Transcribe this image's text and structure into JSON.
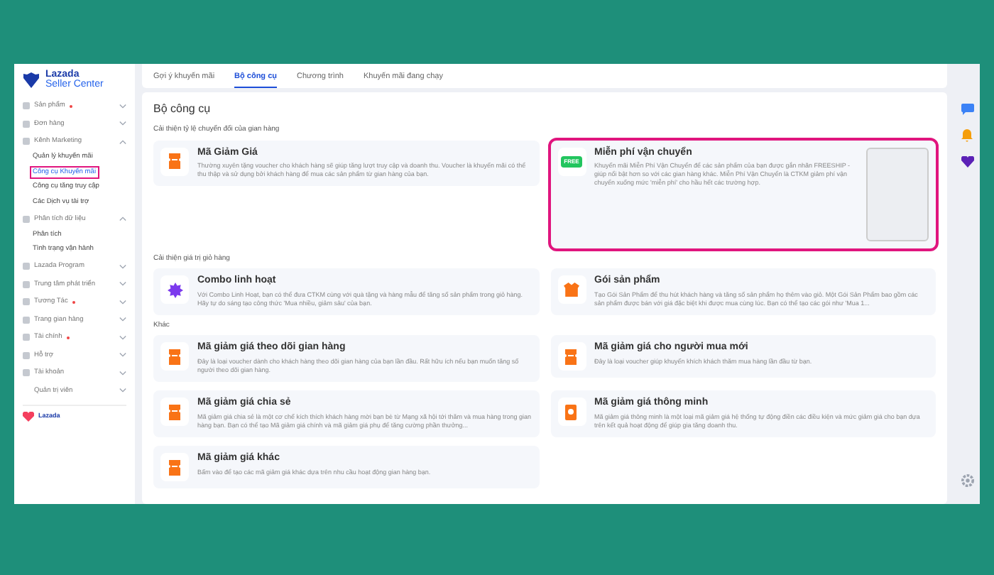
{
  "logo": {
    "line1": "Lazada",
    "line2": "Seller Center"
  },
  "sidebar": {
    "items": [
      {
        "label": "Sản phẩm",
        "kind": "group",
        "alert": true,
        "expanded": false
      },
      {
        "label": "Đơn hàng",
        "kind": "group",
        "alert": false,
        "expanded": false
      },
      {
        "label": "Kênh Marketing",
        "kind": "group",
        "alert": false,
        "expanded": true,
        "children": [
          {
            "label": "Quản lý khuyến mãi",
            "selected": false,
            "highlighted": false
          },
          {
            "label": "Công cụ Khuyến mãi",
            "selected": true,
            "highlighted": true
          },
          {
            "label": "Công cụ tăng truy cập",
            "selected": false,
            "highlighted": false
          },
          {
            "label": "Các Dịch vụ tài trợ",
            "selected": false,
            "highlighted": false
          }
        ]
      },
      {
        "label": "Phân tích dữ liệu",
        "kind": "group",
        "alert": false,
        "expanded": true,
        "children": [
          {
            "label": "Phân tích",
            "selected": false,
            "highlighted": false
          },
          {
            "label": "Tình trạng vận hành",
            "selected": false,
            "highlighted": false
          }
        ]
      },
      {
        "label": "Lazada Program",
        "kind": "group",
        "alert": false,
        "expanded": false
      },
      {
        "label": "Trung tâm phát triển",
        "kind": "group",
        "alert": false,
        "expanded": false
      },
      {
        "label": "Tương Tác",
        "kind": "group",
        "alert": true,
        "expanded": false
      },
      {
        "label": "Trang gian hàng",
        "kind": "group",
        "alert": false,
        "expanded": false
      },
      {
        "label": "Tài chính",
        "kind": "group",
        "alert": true,
        "expanded": false
      },
      {
        "label": "Hỗ trợ",
        "kind": "group",
        "alert": false,
        "expanded": false
      },
      {
        "label": "Tài khoản",
        "kind": "group",
        "alert": false,
        "expanded": false
      },
      {
        "label": "Quản trị viên",
        "kind": "plain",
        "alert": false,
        "expanded": false
      }
    ],
    "footer": "Lazada"
  },
  "tabs": [
    {
      "label": "Gợi ý khuyến mãi",
      "selected": false
    },
    {
      "label": "Bộ công cụ",
      "selected": true
    },
    {
      "label": "Chương trình",
      "selected": false
    },
    {
      "label": "Khuyến mãi đang chạy",
      "selected": false
    }
  ],
  "panel": {
    "title": "Bộ công cụ",
    "sections": [
      {
        "heading": "Cải thiện tỷ lệ chuyển đổi của gian hàng",
        "tools": [
          {
            "title": "Mã Giảm Giá",
            "kind": "voucher",
            "highlighted": false,
            "description": "Thường xuyên tặng voucher cho khách hàng sẽ giúp tăng lượt truy cập và doanh thu. Voucher là khuyến mãi có thể thu thập và sử dụng bởi khách hàng để mua các sản phẩm từ gian hàng của bạn."
          },
          {
            "title": "Miễn phí vận chuyển",
            "kind": "freeship",
            "icon_text": "FREE",
            "highlighted": true,
            "preview": true,
            "description": "Khuyến mãi Miễn Phí Vận Chuyển để các sản phẩm của bạn được gắn nhãn FREESHIP - giúp nổi bật hơn so với các gian hàng khác. Miễn Phí Vận Chuyển là CTKM giảm phí vận chuyển xuống mức 'miễn phí' cho hầu hết các trường hợp."
          }
        ]
      },
      {
        "heading": "Cải thiện giá trị giỏ hàng",
        "tools": [
          {
            "title": "Combo linh hoạt",
            "kind": "combo",
            "highlighted": false,
            "description": "Với Combo Linh Hoạt, bạn có thể đưa CTKM cùng với quà tặng và hàng mẫu để tăng số sản phẩm trong giỏ hàng. Hãy tự do sáng tạo công thức 'Mua nhiều, giảm sâu' của bạn."
          },
          {
            "title": "Gói sản phẩm",
            "kind": "bundle",
            "highlighted": false,
            "description": "Tạo Gói Sản Phẩm để thu hút khách hàng và tăng số sản phẩm họ thêm vào giỏ. Một Gói Sản Phẩm bao gồm các sản phẩm được bán với giá đặc biệt khi được mua cùng lúc. Bạn có thể tạo các gói như 'Mua 1..."
          }
        ]
      },
      {
        "heading": "Khác",
        "tools": [
          {
            "title": "Mã giảm giá theo dõi gian hàng",
            "kind": "voucher",
            "highlighted": false,
            "description": "Đây là loại voucher dành cho khách hàng theo dõi gian hàng của bạn lần đầu. Rất hữu ích nếu bạn muốn tăng số người theo dõi gian hàng."
          },
          {
            "title": "Mã giảm giá cho người mua mới",
            "kind": "voucher",
            "highlighted": false,
            "description": "Đây là loại voucher giúp khuyến khích khách thăm mua hàng lần đầu từ bạn."
          },
          {
            "title": "Mã giảm giá chia sẻ",
            "kind": "voucher",
            "highlighted": false,
            "description": "Mã giảm giá chia sẻ là một cơ chế kích thích khách hàng mời bạn bè từ Mạng xã hội tới thăm và mua hàng trong gian hàng bạn. Bạn có thể tạo Mã giảm giá chính và mã giảm giá phụ để tăng cường phần thưởng..."
          },
          {
            "title": "Mã giảm giá thông minh",
            "kind": "smart",
            "highlighted": false,
            "description": "Mã giảm giá thông minh là một loại mã giảm giá hệ thống tự động điền các điều kiện và mức giảm giá cho bạn dựa trên kết quả hoạt động để giúp gia tăng doanh thu."
          },
          {
            "title": "Mã giảm giá khác",
            "kind": "voucher",
            "highlighted": false,
            "description": "Bấm vào để tạo các mã giảm giá khác dựa trên nhu cầu hoạt động gian hàng bạn."
          }
        ]
      }
    ]
  }
}
